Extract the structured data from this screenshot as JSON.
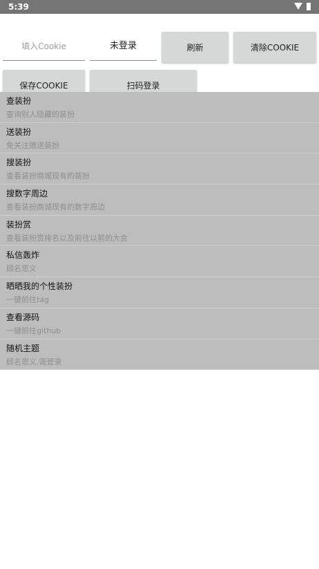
{
  "status_bar": {
    "time": "5:39",
    "icons": [
      "wifi-icon",
      "battery-icon"
    ]
  },
  "header": {
    "cookie_placeholder": "填入Cookie",
    "cookie_value": "",
    "login_status": "未登录",
    "refresh_label": "刷新",
    "clear_cookie_label": "清除COOKIE",
    "save_cookie_label": "保存COOKIE",
    "scan_login_label": "扫码登录"
  },
  "menu": [
    {
      "title": "查装扮",
      "desc": "查询别人隐藏的装扮"
    },
    {
      "title": "送装扮",
      "desc": "免关注赠送装扮"
    },
    {
      "title": "搜装扮",
      "desc": "查看装扮商城现有的装扮"
    },
    {
      "title": "搜数字周边",
      "desc": "查看装扮商城现有的数字周边"
    },
    {
      "title": "装扮赏",
      "desc": "查看装扮赏排名以及前往以前的大会"
    },
    {
      "title": "私信轰炸",
      "desc": "顾名思义"
    },
    {
      "title": "晒晒我的个性装扮",
      "desc": "一键前往tag"
    },
    {
      "title": "查看源码",
      "desc": "一键前往github"
    },
    {
      "title": "随机主题",
      "desc": "顾名思义,需登录"
    }
  ],
  "colors": {
    "status_bar": "#757575",
    "button": "#d6d7d7",
    "list_item": "#bdbdbd",
    "desc_text": "#8e8e8e"
  }
}
